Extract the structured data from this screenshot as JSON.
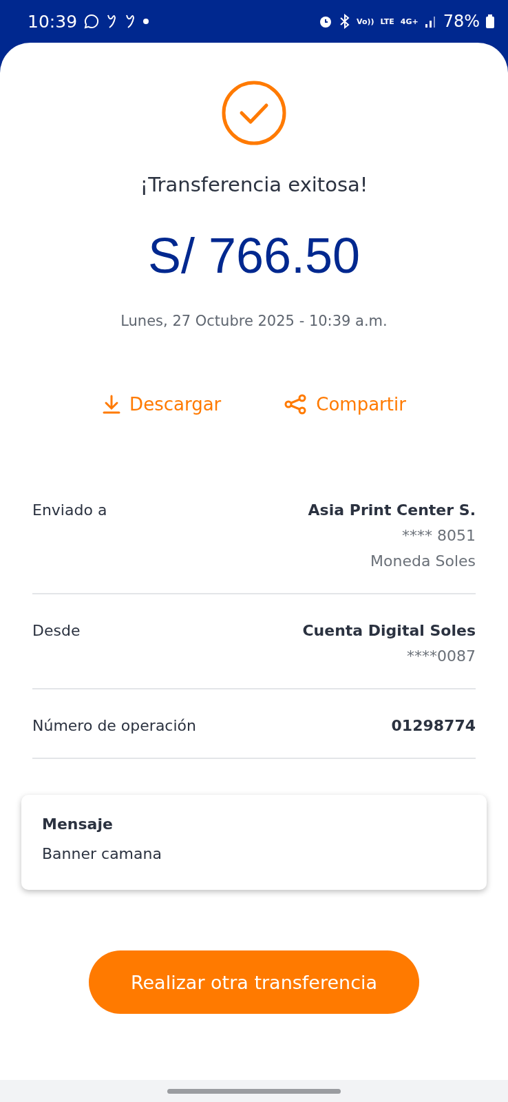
{
  "status_bar": {
    "time": "10:39",
    "network": [
      "Vo))",
      "LTE",
      "4G+"
    ],
    "battery": "78%"
  },
  "result": {
    "title": "¡Transferencia exitosa!",
    "amount": "S/ 766.50",
    "date": "Lunes, 27 Octubre 2025 - 10:39 a.m."
  },
  "actions": [
    {
      "kind": "download",
      "label": "Descargar"
    },
    {
      "kind": "share",
      "label": "Compartir"
    }
  ],
  "details": [
    {
      "label": "Enviado a",
      "values": [
        "Asia Print Center S.",
        "**** 8051",
        "Moneda Soles"
      ]
    },
    {
      "label": "Desde",
      "values": [
        "Cuenta Digital Soles",
        "****0087"
      ]
    },
    {
      "label": "Número de operación",
      "values": [
        "01298774"
      ]
    }
  ],
  "message": {
    "title": "Mensaje",
    "text": "Banner camana"
  },
  "button": "Realizar otra transferencia"
}
